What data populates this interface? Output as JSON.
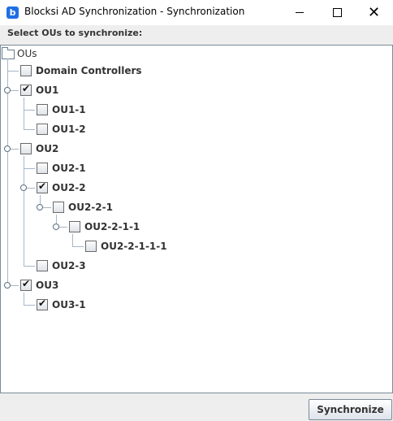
{
  "window": {
    "title": "Blocksi AD Synchronization - Synchronization",
    "app_icon_letter": "b",
    "minimize": "–",
    "maximize": "☐",
    "close": "✕"
  },
  "prompt": "Select OUs to synchronize:",
  "tree": {
    "root_label": "OUs",
    "nodes": [
      {
        "label": "Domain Controllers",
        "checked": false
      },
      {
        "label": "OU1",
        "checked": true
      },
      {
        "label": "OU1-1",
        "checked": false
      },
      {
        "label": "OU1-2",
        "checked": false
      },
      {
        "label": "OU2",
        "checked": false
      },
      {
        "label": "OU2-1",
        "checked": false
      },
      {
        "label": "OU2-2",
        "checked": true
      },
      {
        "label": "OU2-2-1",
        "checked": false
      },
      {
        "label": "OU2-2-1-1",
        "checked": false
      },
      {
        "label": "OU2-2-1-1-1",
        "checked": false
      },
      {
        "label": "OU2-3",
        "checked": false
      },
      {
        "label": "OU3",
        "checked": true
      },
      {
        "label": "OU3-1",
        "checked": true
      }
    ],
    "check_glyph": "✔"
  },
  "buttons": {
    "synchronize": "Synchronize"
  },
  "colors": {
    "accent": "#1e6fe6",
    "tree_lines": "#a8b6c6",
    "panel_border": "#7a8a99"
  }
}
